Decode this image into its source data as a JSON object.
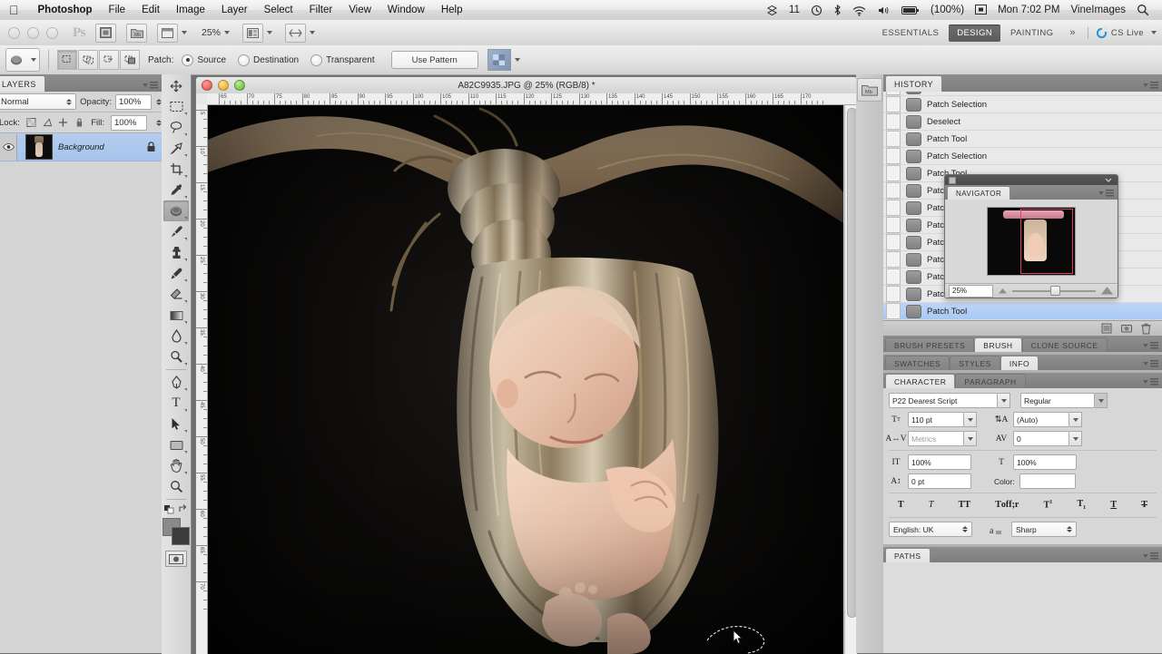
{
  "os_menubar": {
    "apple_icon": "apple-icon",
    "items": [
      {
        "label": "Photoshop",
        "bold": true
      },
      {
        "label": "File",
        "bold": false
      },
      {
        "label": "Edit",
        "bold": false
      },
      {
        "label": "Image",
        "bold": false
      },
      {
        "label": "Layer",
        "bold": false
      },
      {
        "label": "Select",
        "bold": false
      },
      {
        "label": "Filter",
        "bold": false
      },
      {
        "label": "View",
        "bold": false
      },
      {
        "label": "Window",
        "bold": false
      },
      {
        "label": "Help",
        "bold": false
      }
    ],
    "status": {
      "dropbox_count": "11",
      "battery_percent": "(100%)",
      "clock": "Mon 7:02 PM",
      "user": "VineImages",
      "icons": [
        "dropbox-icon",
        "timemachine-icon",
        "bluetooth-icon",
        "wifi-icon",
        "volume-icon",
        "battery-icon",
        "display-icon",
        "spotlight-search-icon"
      ]
    }
  },
  "app_bar": {
    "logo": "Ps",
    "zoom_level": "25%",
    "buttons": [
      "bridge-icon",
      "mini-bridge-icon",
      "view-extras-icon",
      "screen-mode-icon",
      "arrange-documents-icon"
    ],
    "workspaces": [
      {
        "label": "ESSENTIALS",
        "active": false
      },
      {
        "label": "DESIGN",
        "active": true
      },
      {
        "label": "PAINTING",
        "active": false
      }
    ],
    "more": "»",
    "cs_live": "CS Live"
  },
  "options_bar": {
    "tool_preset": "patch-tool-icon",
    "selection_modes": [
      "new-selection-icon",
      "add-to-selection-icon",
      "subtract-from-selection-icon",
      "intersect-selection-icon"
    ],
    "patch_label": "Patch:",
    "radios": [
      {
        "label": "Source",
        "checked": true
      },
      {
        "label": "Destination",
        "checked": false
      },
      {
        "label": "Transparent",
        "checked": false
      }
    ],
    "use_pattern_button": "Use Pattern",
    "pattern_swatch": "pattern-swatch"
  },
  "layers_panel": {
    "tabs": [
      {
        "label": "LAYERS",
        "active": true
      }
    ],
    "blend_mode": "Normal",
    "opacity_label": "Opacity:",
    "opacity_value": "100%",
    "lock_label": "Lock:",
    "lock_icons": [
      "lock-transparency-icon",
      "lock-image-icon",
      "lock-position-icon",
      "lock-all-icon"
    ],
    "fill_label": "Fill:",
    "fill_value": "100%",
    "layers": [
      {
        "name": "Background",
        "locked": true,
        "visible": true,
        "selected": true
      }
    ]
  },
  "toolbar": {
    "tools": [
      {
        "name": "move-tool",
        "glyph": "✥",
        "selected": false,
        "has_submenu": false
      },
      {
        "name": "rectangular-marquee-tool",
        "glyph": "⬚",
        "selected": false,
        "has_submenu": true
      },
      {
        "name": "lasso-tool",
        "glyph": "∠",
        "selected": false,
        "has_submenu": true
      },
      {
        "name": "quick-selection-tool",
        "glyph": "✎",
        "selected": false,
        "has_submenu": true
      },
      {
        "name": "crop-tool",
        "glyph": "⌗",
        "selected": false,
        "has_submenu": true
      },
      {
        "name": "eyedropper-tool",
        "glyph": "✒",
        "selected": false,
        "has_submenu": true
      },
      {
        "name": "patch-tool",
        "glyph": "◉",
        "selected": true,
        "has_submenu": true
      },
      {
        "name": "brush-tool",
        "glyph": "✏",
        "selected": false,
        "has_submenu": true
      },
      {
        "name": "clone-stamp-tool",
        "glyph": "⚓",
        "selected": false,
        "has_submenu": true
      },
      {
        "name": "history-brush-tool",
        "glyph": "✐",
        "selected": false,
        "has_submenu": true
      },
      {
        "name": "eraser-tool",
        "glyph": "▱",
        "selected": false,
        "has_submenu": true
      },
      {
        "name": "gradient-tool",
        "glyph": "▤",
        "selected": false,
        "has_submenu": true
      },
      {
        "name": "blur-tool",
        "glyph": "◌",
        "selected": false,
        "has_submenu": true
      },
      {
        "name": "dodge-tool",
        "glyph": "◔",
        "selected": false,
        "has_submenu": true
      },
      {
        "name": "pen-tool",
        "glyph": "✑",
        "selected": false,
        "has_submenu": true
      },
      {
        "name": "horizontal-type-tool",
        "glyph": "T",
        "selected": false,
        "has_submenu": true
      },
      {
        "name": "path-selection-tool",
        "glyph": "➤",
        "selected": false,
        "has_submenu": true
      },
      {
        "name": "rectangle-tool",
        "glyph": "▭",
        "selected": false,
        "has_submenu": true
      },
      {
        "name": "hand-tool",
        "glyph": "✋",
        "selected": false,
        "has_submenu": true
      },
      {
        "name": "zoom-tool",
        "glyph": "⌕",
        "selected": false,
        "has_submenu": false
      }
    ],
    "foreground_swatch": "#8a8a8a",
    "background_swatch": "#3b3b3b",
    "quick_mask": "quick-mask-icon"
  },
  "document": {
    "title": "A82C9935.JPG @ 25% (RGB/8) *",
    "ruler_units_h": [
      "65",
      "70",
      "75",
      "80",
      "85",
      "90",
      "95",
      "100",
      "105",
      "110",
      "115",
      "120",
      "125",
      "130",
      "135",
      "140",
      "145",
      "150",
      "155",
      "160",
      "165",
      "170"
    ],
    "ruler_units_v": [
      "5",
      "10",
      "15",
      "20",
      "25",
      "30",
      "35",
      "40",
      "45",
      "50",
      "55",
      "60",
      "65",
      "70"
    ],
    "window_controls": [
      "close-button",
      "minimize-button",
      "zoom-button"
    ]
  },
  "history_panel": {
    "tabs": [
      {
        "label": "HISTORY",
        "active": true
      }
    ],
    "items": [
      {
        "label": "Patch Tool",
        "icon": "patch-state-icon",
        "selected": false
      },
      {
        "label": "Patch Selection",
        "icon": "patch-state-icon",
        "selected": false
      },
      {
        "label": "Deselect",
        "icon": "deselect-state-icon",
        "selected": false
      },
      {
        "label": "Patch Tool",
        "icon": "patch-state-icon",
        "selected": false
      },
      {
        "label": "Patch Selection",
        "icon": "patch-state-icon",
        "selected": false
      },
      {
        "label": "Patch Tool",
        "icon": "patch-state-icon",
        "selected": false
      },
      {
        "label": "Patch Selection",
        "icon": "patch-state-icon",
        "selected": false
      },
      {
        "label": "Patch Tool",
        "icon": "patch-state-icon",
        "selected": false
      },
      {
        "label": "Patch Selection",
        "icon": "patch-state-icon",
        "selected": false
      },
      {
        "label": "Patch Tool",
        "icon": "patch-state-icon",
        "selected": false
      },
      {
        "label": "Patch Selection",
        "icon": "patch-state-icon",
        "selected": false
      },
      {
        "label": "Patch Tool",
        "icon": "patch-state-icon",
        "selected": false
      },
      {
        "label": "Patch Selection",
        "icon": "patch-state-icon",
        "selected": false
      },
      {
        "label": "Patch Tool",
        "icon": "patch-state-icon",
        "selected": true
      }
    ],
    "footer_buttons": [
      "new-document-from-state-icon",
      "new-snapshot-icon",
      "delete-state-icon"
    ]
  },
  "navigator_panel": {
    "tabs": [
      {
        "label": "NAVIGATOR",
        "active": true
      }
    ],
    "zoom_value": "25%",
    "zoom_out_icon": "zoom-out-icon",
    "zoom_in_icon": "zoom-in-icon",
    "view_box_color": "#e0425f"
  },
  "dock_tabs": {
    "row1": [
      {
        "label": "BRUSH PRESETS",
        "active": false
      },
      {
        "label": "BRUSH",
        "active": true
      },
      {
        "label": "CLONE SOURCE",
        "active": false
      }
    ],
    "row2": [
      {
        "label": "SWATCHES",
        "active": false
      },
      {
        "label": "STYLES",
        "active": false
      },
      {
        "label": "INFO",
        "active": true
      }
    ],
    "row3": [
      {
        "label": "CHARACTER",
        "active": true
      },
      {
        "label": "PARAGRAPH",
        "active": false
      }
    ],
    "row4": [
      {
        "label": "PATHS",
        "active": true
      }
    ]
  },
  "character_panel": {
    "font_family": "P22 Dearest Script",
    "font_style": "Regular",
    "size_icon": "font-size-icon",
    "size": "110 pt",
    "leading_icon": "leading-icon",
    "leading": "(Auto)",
    "kerning_icon": "kerning-icon",
    "kerning": "Metrics",
    "tracking_icon": "tracking-icon",
    "tracking": "0",
    "vscale_icon": "vertical-scale-icon",
    "vertical_scale": "100%",
    "hscale_icon": "horizontal-scale-icon",
    "horizontal_scale": "100%",
    "baseline_icon": "baseline-shift-icon",
    "baseline_shift": "0 pt",
    "color_label": "Color:",
    "color_value": "#ffffff",
    "style_buttons": [
      "faux-bold-icon",
      "faux-italic-icon",
      "all-caps-icon",
      "small-caps-icon",
      "superscript-icon",
      "subscript-icon",
      "underline-icon",
      "strikethrough-icon"
    ],
    "language": "English: UK",
    "antialias_icon": "anti-alias-icon",
    "antialias": "Sharp"
  },
  "dock_icon_rail": {
    "icons": [
      "mini-bridge-panel-icon"
    ]
  },
  "colors": {
    "accent_selection": "#a9c9f2",
    "workspace_active": "#6f6f6f",
    "panel_bg": "#d2d2d2",
    "app_bg": "#6e6e6e",
    "canvas_bg": "#0a0a0a"
  }
}
